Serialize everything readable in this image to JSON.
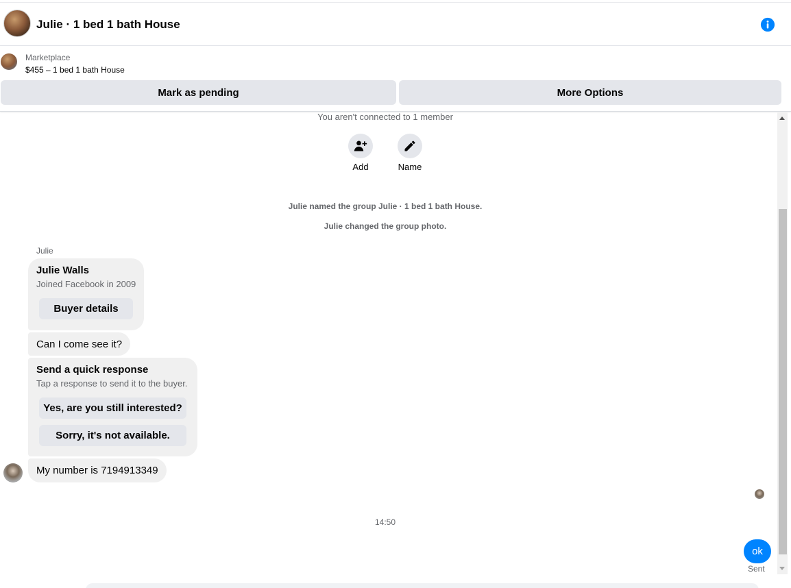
{
  "header": {
    "title": "Julie · 1 bed 1 bath House",
    "info_icon": "info-icon",
    "accent_color": "#0084ff"
  },
  "listing": {
    "category": "Marketplace",
    "price_line": "$455 – 1 bed 1 bath House",
    "mark_pending_label": "Mark as pending",
    "more_options_label": "More Options"
  },
  "conversation": {
    "connection_notice": "You aren't connected to 1 member",
    "actions": [
      {
        "label": "Add",
        "icon": "add-person-icon"
      },
      {
        "label": "Name",
        "icon": "pencil-icon"
      }
    ],
    "system_messages": [
      "Julie named the group Julie · 1 bed 1 bath House.",
      "Julie changed the group photo."
    ],
    "sender_name": "Julie",
    "buyer_card": {
      "name": "Julie Walls",
      "subtitle": "Joined Facebook in 2009",
      "button_label": "Buyer details"
    },
    "message_1": "Can I come see it?",
    "quick_response": {
      "title": "Send a quick response",
      "subtitle": "Tap a response to send it to the buyer.",
      "options": [
        "Yes, are you still interested?",
        "Sorry, it's not available."
      ]
    },
    "message_2": "My number is 7194913349",
    "timestamp": "14:50",
    "outgoing_message": "ok",
    "outgoing_status": "Sent"
  }
}
